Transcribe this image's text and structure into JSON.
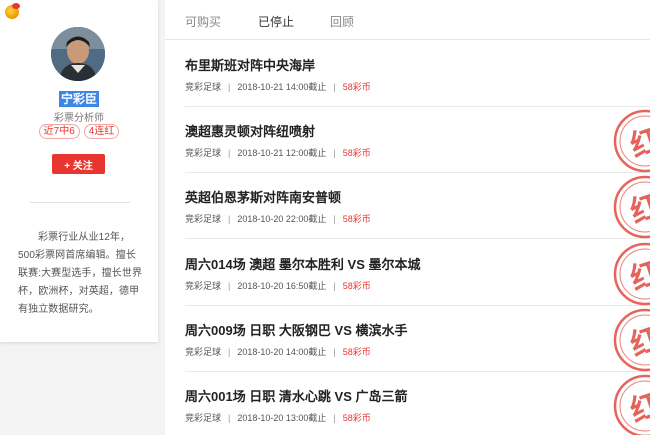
{
  "profile": {
    "name": "宁彩臣",
    "role": "彩票分析师",
    "badges": [
      "近7中6",
      "4连红"
    ],
    "follow_label": "+ 关注",
    "bio": "彩票行业从业12年，500彩票网首席编辑。擅长联赛:大赛型选手，擅长世界杯，欧洲杯，对英超，德甲有独立数据研究。"
  },
  "tabs": [
    {
      "label": "可购买",
      "active": false
    },
    {
      "label": "已停止",
      "active": true
    },
    {
      "label": "回顾",
      "active": false
    }
  ],
  "items": [
    {
      "title": "布里斯班对阵中央海岸",
      "category": "竞彩足球",
      "deadline": "2018-10-21 14:00截止",
      "price": "58彩币",
      "stamp": false
    },
    {
      "title": "澳超惠灵顿对阵纽喷射",
      "category": "竞彩足球",
      "deadline": "2018-10-21 12:00截止",
      "price": "58彩币",
      "stamp": true
    },
    {
      "title": "英超伯恩茅斯对阵南安普顿",
      "category": "竞彩足球",
      "deadline": "2018-10-20 22:00截止",
      "price": "58彩币",
      "stamp": true
    },
    {
      "title": "周六014场 澳超 墨尔本胜利 VS 墨尔本城",
      "category": "竞彩足球",
      "deadline": "2018-10-20 16:50截止",
      "price": "58彩币",
      "stamp": true
    },
    {
      "title": "周六009场 日职 大阪钢巴 VS 横滨水手",
      "category": "竞彩足球",
      "deadline": "2018-10-20 14:00截止",
      "price": "58彩币",
      "stamp": true
    },
    {
      "title": "周六001场 日职 清水心跳 VS 广岛三箭",
      "category": "竞彩足球",
      "deadline": "2018-10-20 13:00截止",
      "price": "58彩币",
      "stamp": true
    }
  ],
  "stamp_text": "红",
  "colors": {
    "accent": "#e8352f",
    "highlight": "#3b86e6"
  }
}
